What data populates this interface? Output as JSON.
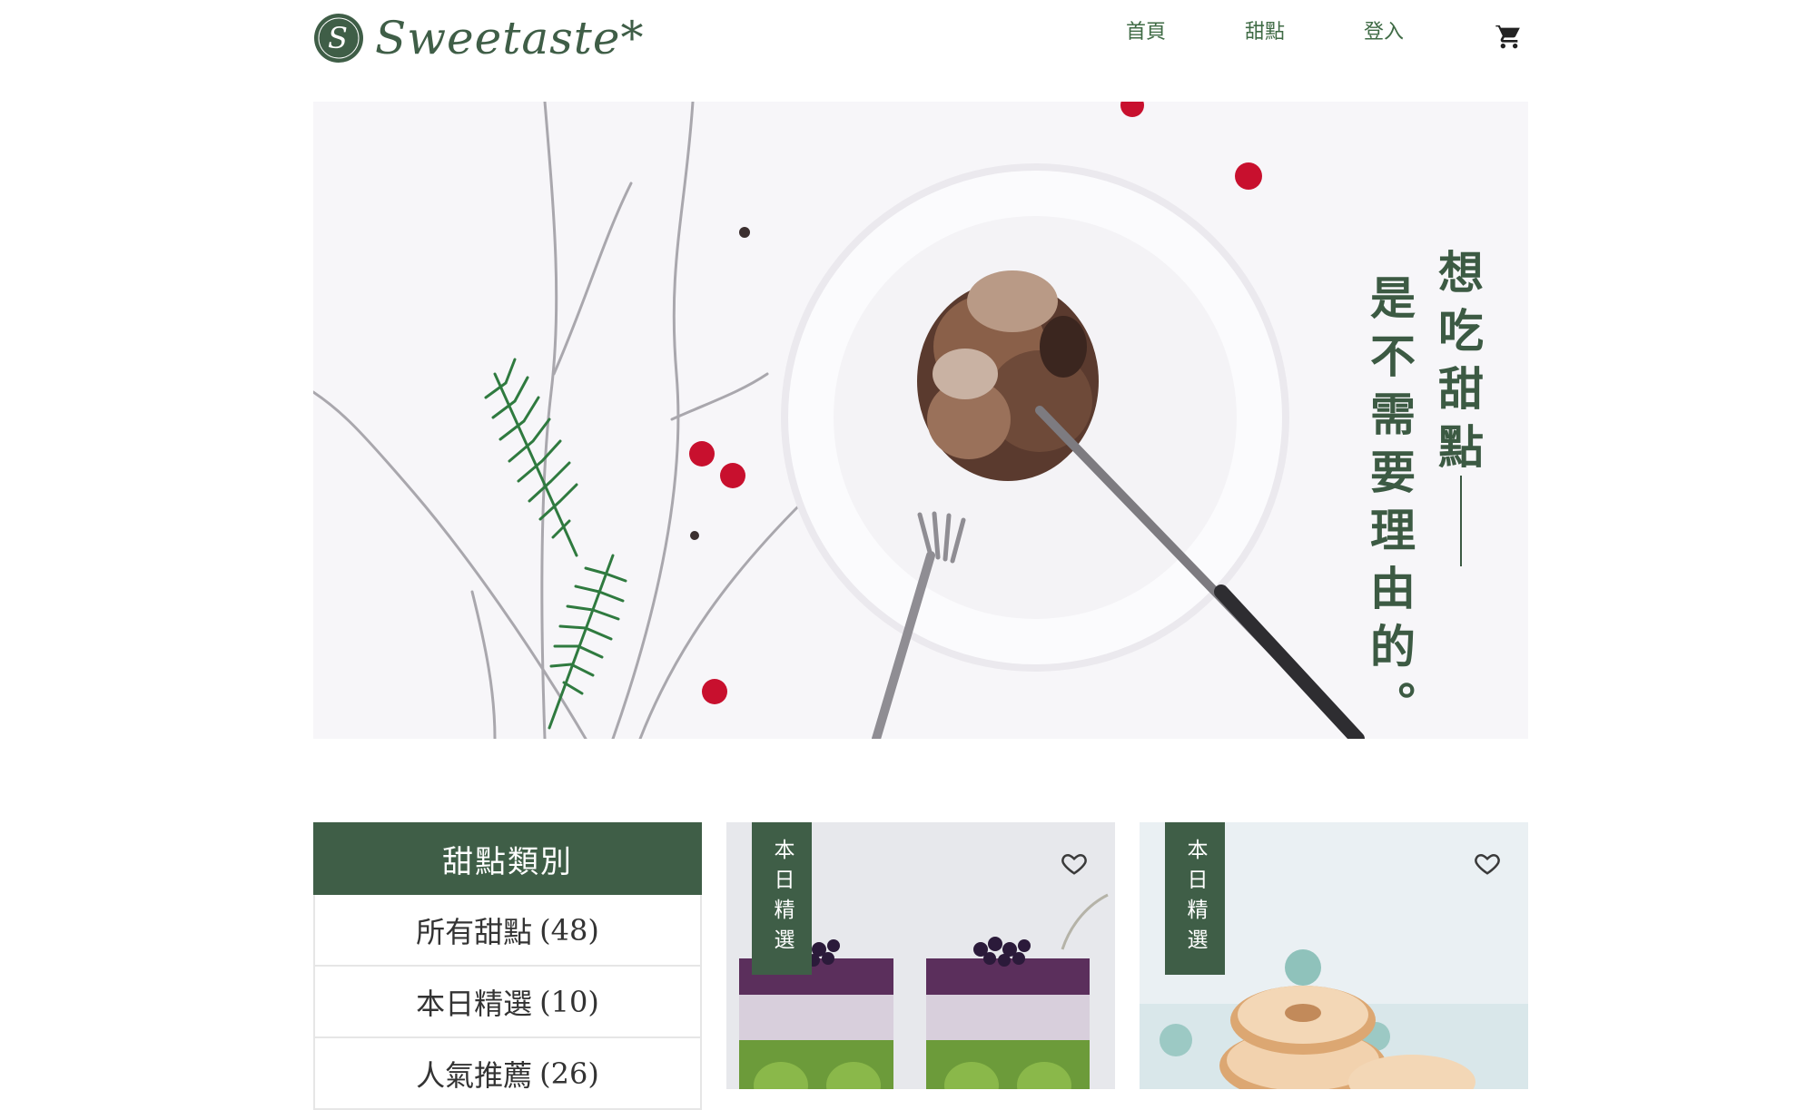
{
  "brand": {
    "name": "Sweetaste*",
    "mark_letter": "S"
  },
  "nav": {
    "home": "首頁",
    "desserts": "甜點",
    "login": "登入",
    "cart_icon": "cart-icon"
  },
  "banner": {
    "slogan_line1": "想吃甜點",
    "slogan_line2": "是不需要理由的。"
  },
  "categories": {
    "title": "甜點類別",
    "items": [
      {
        "label": "所有甜點",
        "count": "(48)"
      },
      {
        "label": "本日精選",
        "count": "(10)"
      },
      {
        "label": "人氣推薦",
        "count": "(26)"
      }
    ]
  },
  "products": [
    {
      "badge": "本日精選",
      "favorite_icon": "heart-outline-icon"
    },
    {
      "badge": "本日精選",
      "favorite_icon": "heart-outline-icon"
    }
  ],
  "colors": {
    "brand_green": "#3f5e47",
    "nav_green": "#3f6b45",
    "berry_red": "#c8102e"
  }
}
